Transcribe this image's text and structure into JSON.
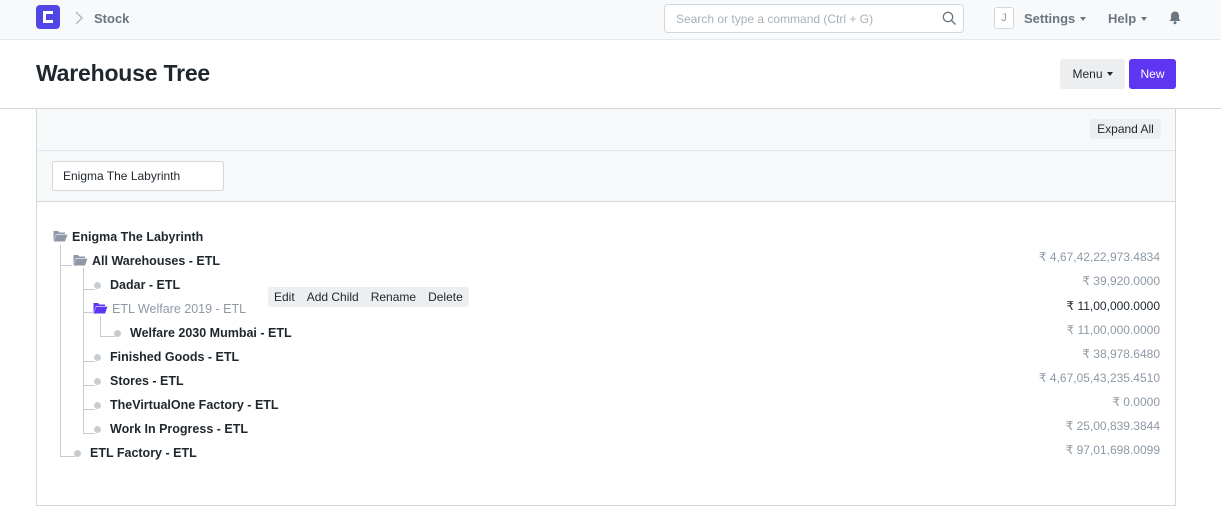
{
  "navbar": {
    "breadcrumb": "Stock",
    "search_placeholder": "Search or type a command (Ctrl + G)",
    "avatar_initial": "J",
    "settings_label": "Settings",
    "help_label": "Help"
  },
  "page": {
    "title": "Warehouse Tree",
    "menu_label": "Menu",
    "new_label": "New"
  },
  "tree_toolbar": {
    "expand_all_label": "Expand All",
    "company_value": "Enigma The Labyrinth"
  },
  "tree": {
    "root": "Enigma The Labyrinth",
    "nodes": [
      {
        "label": "All Warehouses - ETL",
        "value": "₹ 4,67,42,22,973.4834"
      },
      {
        "label": "Dadar - ETL",
        "value": "₹ 39,920.0000"
      },
      {
        "label": "ETL Welfare 2019 - ETL",
        "value": "₹ 11,00,000.0000"
      },
      {
        "label": "Welfare 2030 Mumbai - ETL",
        "value": "₹ 11,00,000.0000"
      },
      {
        "label": "Finished Goods - ETL",
        "value": "₹ 38,978.6480"
      },
      {
        "label": "Stores - ETL",
        "value": "₹ 4,67,05,43,235.4510"
      },
      {
        "label": "TheVirtualOne Factory - ETL",
        "value": "₹ 0.0000"
      },
      {
        "label": "Work In Progress - ETL",
        "value": "₹ 25,00,839.3844"
      },
      {
        "label": "ETL Factory - ETL",
        "value": "₹ 97,01,698.0099"
      }
    ],
    "node_actions": [
      "Edit",
      "Add Child",
      "Rename",
      "Delete"
    ]
  },
  "colors": {
    "brand": "#4f46e5",
    "primary_button": "#5e35f1"
  }
}
